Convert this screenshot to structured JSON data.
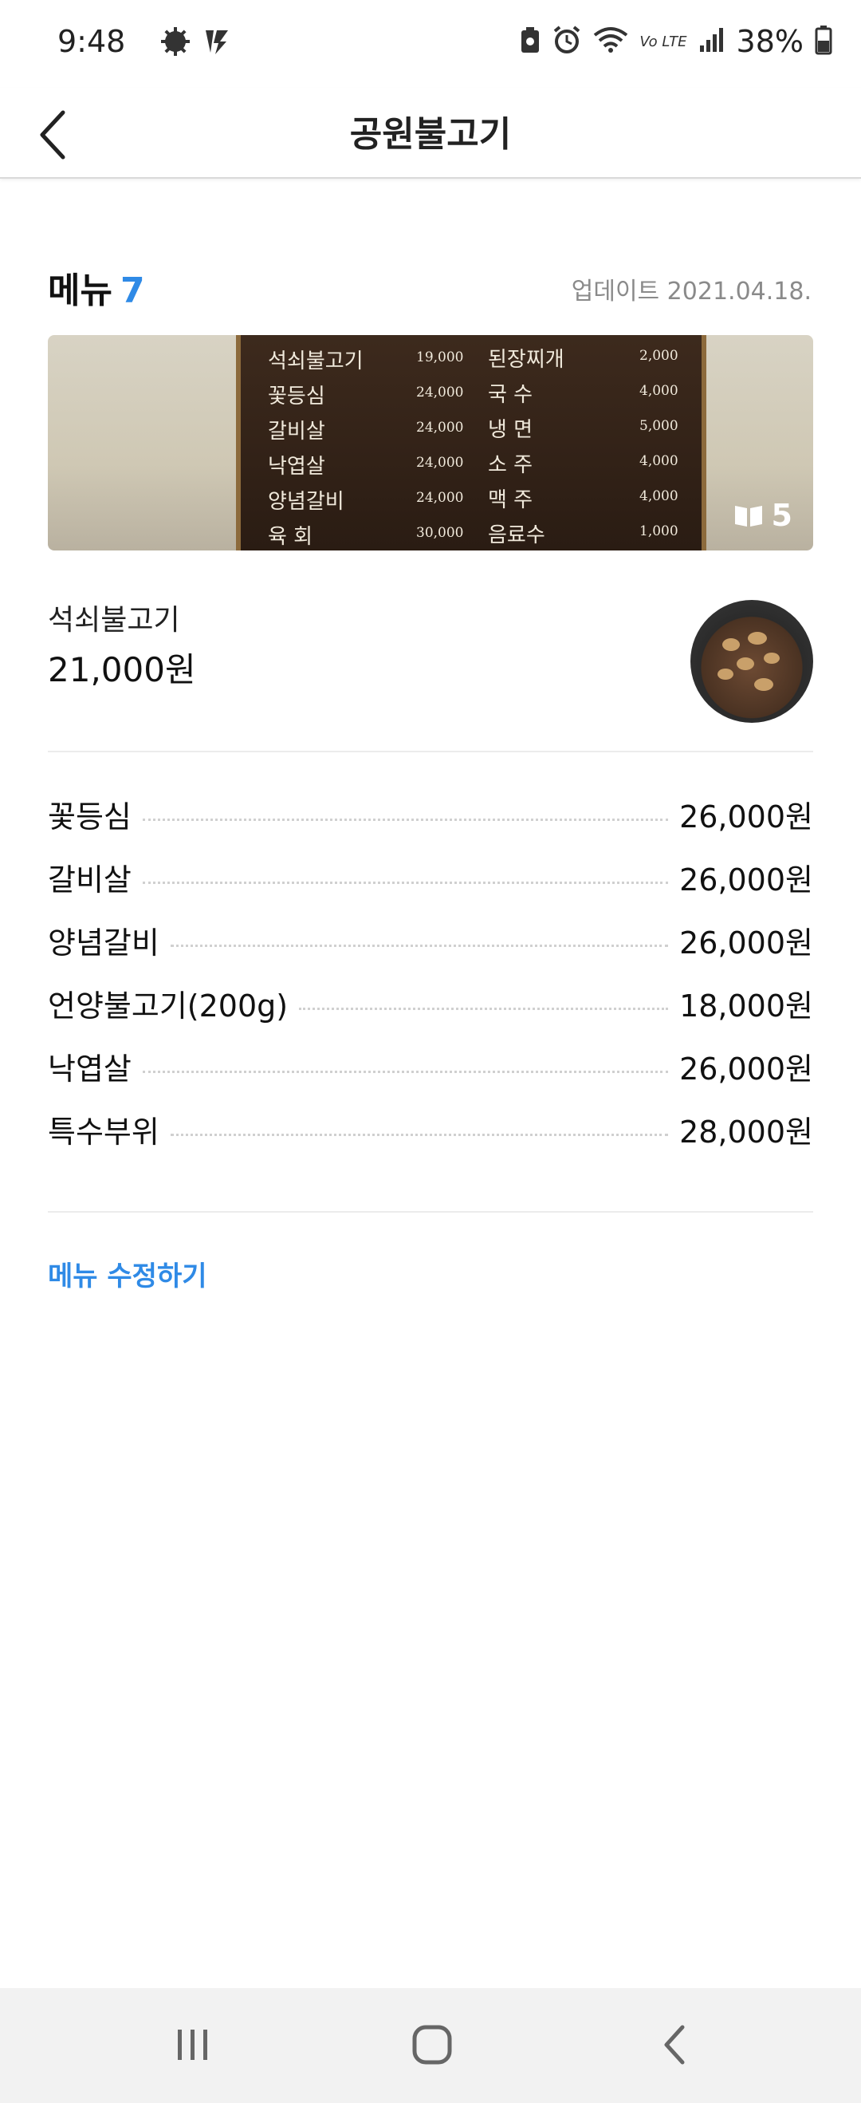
{
  "status_bar": {
    "time": "9:48",
    "battery_pct": "38%",
    "icons": [
      "settings-gear-icon",
      "lightning-icon",
      "battery-saver-icon",
      "alarm-icon",
      "wifi-icon",
      "volte-icon",
      "signal-icon",
      "battery-icon"
    ],
    "volte_label": "Vo LTE"
  },
  "header": {
    "title": "공원불고기",
    "back_icon": "chevron-left-icon"
  },
  "menu": {
    "heading": "메뉴",
    "count": "7",
    "update_label": "업데이트 2021.04.18.",
    "photo_count": "5",
    "photo_board": {
      "left": [
        {
          "name": "석쇠불고기",
          "price": "19,000"
        },
        {
          "name": "꽃등심",
          "price": "24,000"
        },
        {
          "name": "갈비살",
          "price": "24,000"
        },
        {
          "name": "낙엽살",
          "price": "24,000"
        },
        {
          "name": "양념갈비",
          "price": "24,000"
        },
        {
          "name": "육 회",
          "price": "30,000"
        }
      ],
      "right": [
        {
          "name": "된장찌개",
          "price": "2,000"
        },
        {
          "name": "국 수",
          "price": "4,000"
        },
        {
          "name": "냉 면",
          "price": "5,000"
        },
        {
          "name": "소 주",
          "price": "4,000"
        },
        {
          "name": "맥 주",
          "price": "4,000"
        },
        {
          "name": "음료수",
          "price": "1,000"
        }
      ]
    },
    "featured": {
      "name": "석쇠불고기",
      "price": "21,000원"
    },
    "items": [
      {
        "name": "꽃등심",
        "price": "26,000원"
      },
      {
        "name": "갈비살",
        "price": "26,000원"
      },
      {
        "name": "양념갈비",
        "price": "26,000원"
      },
      {
        "name": "언양불고기(200g)",
        "price": "18,000원"
      },
      {
        "name": "낙엽살",
        "price": "26,000원"
      },
      {
        "name": "특수부위",
        "price": "28,000원"
      }
    ],
    "edit_label": "메뉴 수정하기"
  },
  "colors": {
    "accent": "#2f8ae6",
    "muted": "#8a8a8a",
    "nav_bg": "#f2f2f2"
  },
  "nav_bar": {
    "buttons": [
      "recent-apps-icon",
      "home-icon",
      "back-icon"
    ]
  }
}
